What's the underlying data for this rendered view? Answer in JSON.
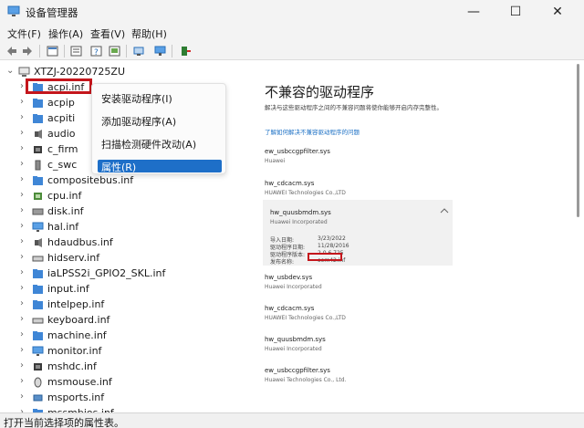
{
  "window": {
    "title": "设备管理器",
    "minimize_glyph": "—",
    "maximize_glyph": "☐",
    "close_glyph": "✕"
  },
  "menu": [
    "文件(F)",
    "操作(A)",
    "查看(V)",
    "帮助(H)"
  ],
  "toolbar_icons": [
    "back-arrow-icon",
    "forward-arrow-icon",
    "properties-icon",
    "list-icon",
    "help-icon",
    "device-view-icon",
    "scan-hardware-icon",
    "add-driver-icon"
  ],
  "tree": {
    "root": "XTZJ-20220725ZU",
    "items": [
      {
        "label": "acpi.inf",
        "icon": "folder-icon"
      },
      {
        "label": "acpip",
        "icon": "folder-icon"
      },
      {
        "label": "acpiti",
        "icon": "folder-icon"
      },
      {
        "label": "audio",
        "icon": "audio-icon"
      },
      {
        "label": "c_firm",
        "icon": "chip-icon"
      },
      {
        "label": "c_swc",
        "icon": "device-icon"
      },
      {
        "label": "compositebus.inf",
        "icon": "folder-icon"
      },
      {
        "label": "cpu.inf",
        "icon": "cpu-icon"
      },
      {
        "label": "disk.inf",
        "icon": "disk-icon"
      },
      {
        "label": "hal.inf",
        "icon": "monitor-icon"
      },
      {
        "label": "hdaudbus.inf",
        "icon": "audio-icon"
      },
      {
        "label": "hidserv.inf",
        "icon": "keyboard-icon"
      },
      {
        "label": "iaLPSS2i_GPIO2_SKL.inf",
        "icon": "folder-icon"
      },
      {
        "label": "input.inf",
        "icon": "folder-icon"
      },
      {
        "label": "intelpep.inf",
        "icon": "folder-icon"
      },
      {
        "label": "keyboard.inf",
        "icon": "keyboard-icon"
      },
      {
        "label": "machine.inf",
        "icon": "folder-icon"
      },
      {
        "label": "monitor.inf",
        "icon": "monitor-icon"
      },
      {
        "label": "mshdc.inf",
        "icon": "chip-icon"
      },
      {
        "label": "msmouse.inf",
        "icon": "mouse-icon"
      },
      {
        "label": "msports.inf",
        "icon": "port-icon"
      },
      {
        "label": "mssmbios.inf",
        "icon": "folder-icon"
      }
    ]
  },
  "context_menu": {
    "items": [
      "安装驱动程序(I)",
      "添加驱动程序(A)",
      "扫描检测硬件改动(A)",
      "属性(R)"
    ],
    "selected_index": 3
  },
  "panel": {
    "title": "不兼容的驱动程序",
    "desc": "解决与这些驱动程序之间的不兼容问题将使你能够开启内存完整性。",
    "link": "了解如何解决不兼容驱动程序的问题",
    "drivers": [
      {
        "name": "ew_usbccgpfilter.sys",
        "vendor": "Huawei"
      },
      {
        "name": "hw_cdcacm.sys",
        "vendor": "HUAWEI Technologies Co.,LTD"
      },
      {
        "name": "hw_quusbmdm.sys",
        "vendor": "Huawei Incorporated",
        "expanded": true
      },
      {
        "name": "hw_usbdev.sys",
        "vendor": "Huawei Incorporated"
      },
      {
        "name": "hw_cdcacm.sys",
        "vendor": "HUAWEI Technologies Co.,LTD"
      },
      {
        "name": "hw_quusbmdm.sys",
        "vendor": "Huawei Incorporated"
      },
      {
        "name": "ew_usbccgpfilter.sys",
        "vendor": "Huawei Technologies Co., Ltd."
      }
    ],
    "details": {
      "import_date_label": "导入日期:",
      "import_date": "3/23/2022",
      "driver_date_label": "驱动程序日期:",
      "driver_date": "11/28/2016",
      "driver_version_label": "驱动程序版本:",
      "driver_version": "2.0.6.725",
      "published_label": "发布名称:",
      "published": "oem42.inf"
    }
  },
  "status": "打开当前选择项的属性表。",
  "colors": {
    "accent": "#1e6fc8",
    "highlight_box": "#c4161c",
    "link": "#1a6fc4"
  }
}
